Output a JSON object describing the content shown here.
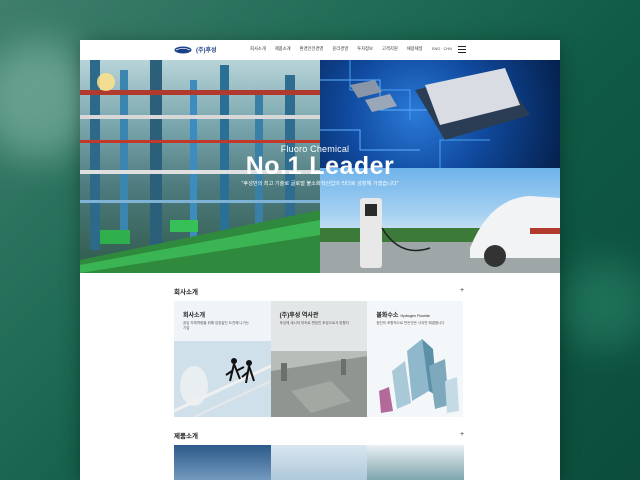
{
  "header": {
    "logo_text": "(주)후성",
    "nav": [
      "회사소개",
      "제품소개",
      "환경안전경영",
      "윤리경영",
      "투자정보",
      "고객지원",
      "채용채널"
    ],
    "lang": "ENG · CHN"
  },
  "hero": {
    "subtitle": "Fluoro Chemical",
    "title": "No.1 Leader",
    "description": "\"후성만의 최고 기술로 글로벌 불소화학산업의 리더로 성장해 가겠습니다\""
  },
  "company_section": {
    "title": "회사소개",
    "cards": [
      {
        "title": "회사소개",
        "tag": "",
        "desc": "끊임 자체역량을 위해 성장같단\n도전해 나가는 기업"
      },
      {
        "title": "(주)후성 역사관",
        "tag": "",
        "desc": "후성에 새시작 마속로 변방친 \n후성으로서 방향다"
      },
      {
        "title": "불화수소",
        "tag": "Hydrogen Fluoride",
        "desc": "첨단의 포함적으로 만든안든\n사지만 해결합니다"
      }
    ]
  },
  "product_section": {
    "title": "제품소개"
  },
  "colors": {
    "brand": "#1c3f8a",
    "accent": "#1a7a5c"
  }
}
